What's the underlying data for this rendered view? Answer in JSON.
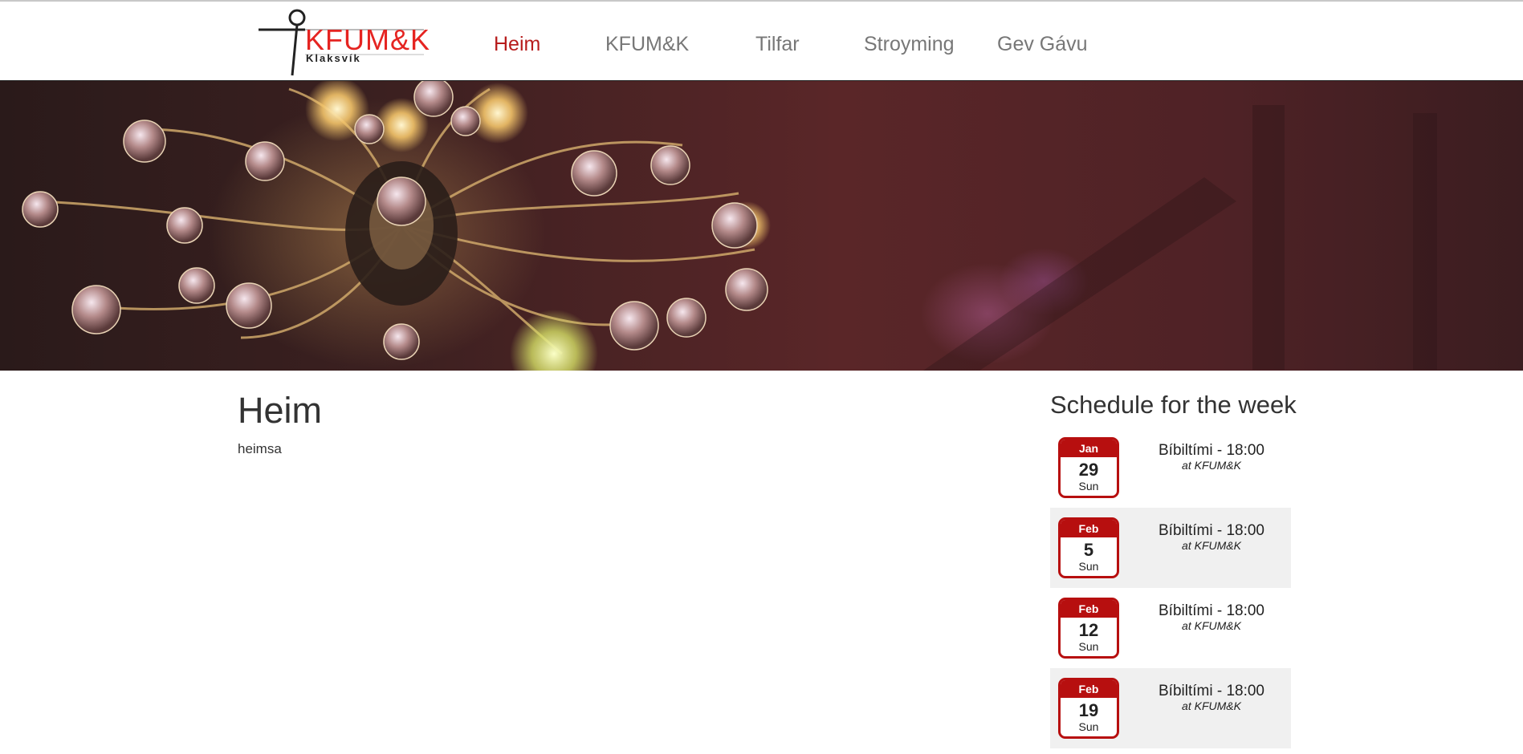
{
  "logo": {
    "title": "KFUM&K",
    "subtitle": "Klaksvík"
  },
  "nav": {
    "items": [
      {
        "label": "Heim",
        "active": true
      },
      {
        "label": "KFUM&K",
        "active": false
      },
      {
        "label": "Tilfar",
        "active": false
      },
      {
        "label": "Stroyming",
        "active": false
      },
      {
        "label": "Gev Gávu",
        "active": false
      }
    ]
  },
  "colors": {
    "accent": "#b71c1c",
    "calendar": "#b70f0f",
    "logo": "#e52421"
  },
  "page": {
    "title": "Heim",
    "text": "heimsa"
  },
  "schedule": {
    "title": "Schedule for the week",
    "events": [
      {
        "month": "Jan",
        "day": "29",
        "weekday": "Sun",
        "title": "Bíbiltími - 18:00",
        "location": "at KFUM&K"
      },
      {
        "month": "Feb",
        "day": "5",
        "weekday": "Sun",
        "title": "Bíbiltími - 18:00",
        "location": "at KFUM&K"
      },
      {
        "month": "Feb",
        "day": "12",
        "weekday": "Sun",
        "title": "Bíbiltími - 18:00",
        "location": "at KFUM&K"
      },
      {
        "month": "Feb",
        "day": "19",
        "weekday": "Sun",
        "title": "Bíbiltími - 18:00",
        "location": "at KFUM&K"
      }
    ]
  }
}
